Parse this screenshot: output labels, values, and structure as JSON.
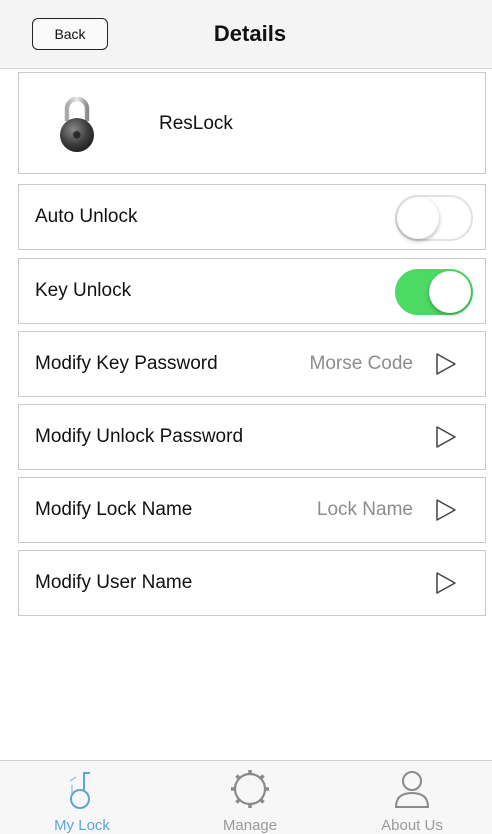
{
  "header": {
    "back_label": "Back",
    "title": "Details"
  },
  "lock": {
    "name": "ResLock",
    "icon": "padlock-icon"
  },
  "settings": [
    {
      "label": "Auto Unlock",
      "type": "toggle",
      "on": false
    },
    {
      "label": "Key Unlock",
      "type": "toggle",
      "on": true
    },
    {
      "label": "Modify Key Password",
      "type": "link",
      "value": "Morse Code"
    },
    {
      "label": "Modify Unlock Password",
      "type": "link",
      "value": ""
    },
    {
      "label": "Modify Lock Name",
      "type": "link",
      "value": "Lock Name"
    },
    {
      "label": "Modify User Name",
      "type": "link",
      "value": ""
    }
  ],
  "tabs": [
    {
      "label": "My Lock",
      "icon": "key-lock-icon",
      "active": true
    },
    {
      "label": "Manage",
      "icon": "gear-icon",
      "active": false
    },
    {
      "label": "About Us",
      "icon": "user-icon",
      "active": false
    }
  ],
  "colors": {
    "toggle_on": "#4cd964",
    "tab_active": "#5aa6d8",
    "tab_inactive": "#9a9a9a",
    "secondary_text": "#8c8c8c"
  }
}
